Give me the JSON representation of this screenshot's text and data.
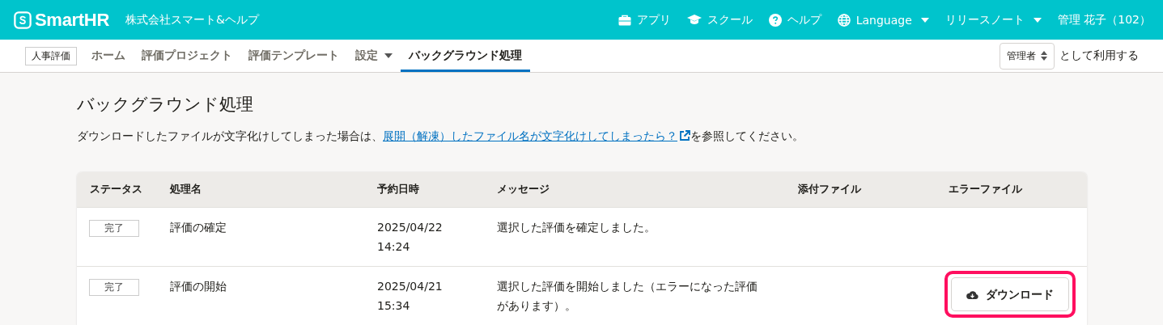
{
  "header": {
    "logo": "SmartHR",
    "company": "株式会社スマート&ヘルプ",
    "links": [
      {
        "kind": "apps",
        "label": "アプリ",
        "dropdown": false
      },
      {
        "kind": "school",
        "label": "スクール",
        "dropdown": false
      },
      {
        "kind": "help",
        "label": "ヘルプ",
        "dropdown": false
      },
      {
        "kind": "language",
        "label": "Language",
        "dropdown": true
      },
      {
        "kind": "notes",
        "label": "リリースノート",
        "dropdown": true
      }
    ],
    "user": "管理 花子（102）"
  },
  "nav": {
    "app_label": "人事評価",
    "items": [
      {
        "label": "ホーム",
        "selected": false,
        "dropdown": false
      },
      {
        "label": "評価プロジェクト",
        "selected": false,
        "dropdown": false
      },
      {
        "label": "評価テンプレート",
        "selected": false,
        "dropdown": false
      },
      {
        "label": "設定",
        "selected": false,
        "dropdown": true
      },
      {
        "label": "バックグラウンド処理",
        "selected": true,
        "dropdown": false
      }
    ],
    "role_select": "管理者",
    "role_suffix": "として利用する"
  },
  "page": {
    "title": "バックグラウンド処理",
    "note_before": "ダウンロードしたファイルが文字化けしてしまった場合は、",
    "note_link": "展開（解凍）したファイル名が文字化けしてしまったら？",
    "note_after": "を参照してください。"
  },
  "table": {
    "columns": [
      "ステータス",
      "処理名",
      "予約日時",
      "メッセージ",
      "添付ファイル",
      "エラーファイル"
    ],
    "rows": [
      {
        "status": "完了",
        "name": "評価の確定",
        "date": "2025/04/22",
        "time": "14:24",
        "message": "選択した評価を確定しました。"
      },
      {
        "status": "完了",
        "name": "評価の開始",
        "date": "2025/04/21",
        "time": "15:34",
        "message": "選択した評価を開始しました（エラーになった評価があります）。",
        "error_button": {
          "label": "ダウンロード",
          "highlighted": true
        }
      }
    ]
  }
}
